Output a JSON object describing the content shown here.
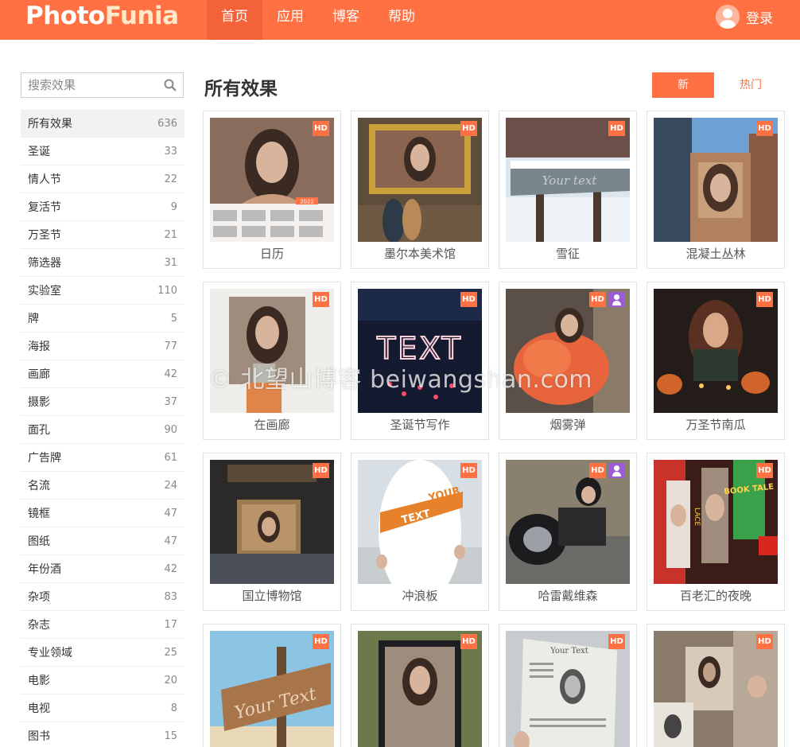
{
  "brand": {
    "photo": "Photo",
    "funia": "Funia"
  },
  "nav": [
    {
      "label": "首页"
    },
    {
      "label": "应用"
    },
    {
      "label": "博客"
    },
    {
      "label": "帮助"
    }
  ],
  "login": {
    "label": "登录"
  },
  "search": {
    "placeholder": "搜索效果"
  },
  "categories": [
    {
      "name": "所有效果",
      "count": "636"
    },
    {
      "name": "圣诞",
      "count": "33"
    },
    {
      "name": "情人节",
      "count": "22"
    },
    {
      "name": "复活节",
      "count": "9"
    },
    {
      "name": "万圣节",
      "count": "21"
    },
    {
      "name": "筛选器",
      "count": "31"
    },
    {
      "name": "实验室",
      "count": "110"
    },
    {
      "name": "牌",
      "count": "5"
    },
    {
      "name": "海报",
      "count": "77"
    },
    {
      "name": "画廊",
      "count": "42"
    },
    {
      "name": "摄影",
      "count": "37"
    },
    {
      "name": "面孔",
      "count": "90"
    },
    {
      "name": "广告牌",
      "count": "61"
    },
    {
      "name": "名流",
      "count": "24"
    },
    {
      "name": "镜框",
      "count": "47"
    },
    {
      "name": "图纸",
      "count": "47"
    },
    {
      "name": "年份酒",
      "count": "42"
    },
    {
      "name": "杂项",
      "count": "83"
    },
    {
      "name": "杂志",
      "count": "17"
    },
    {
      "name": "专业领域",
      "count": "25"
    },
    {
      "name": "电影",
      "count": "20"
    },
    {
      "name": "电视",
      "count": "8"
    },
    {
      "name": "图书",
      "count": "15"
    }
  ],
  "main": {
    "title": "所有效果",
    "sort_new": "新",
    "sort_hot": "热门",
    "hd_label": "HD"
  },
  "effects": [
    {
      "name": "日历"
    },
    {
      "name": "墨尔本美术馆"
    },
    {
      "name": "雪征"
    },
    {
      "name": "混凝土丛林"
    },
    {
      "name": "在画廊"
    },
    {
      "name": "圣诞节写作"
    },
    {
      "name": "烟雾弹"
    },
    {
      "name": "万圣节南瓜"
    },
    {
      "name": "国立博物馆"
    },
    {
      "name": "冲浪板"
    },
    {
      "name": "哈雷戴维森"
    },
    {
      "name": "百老汇的夜晚"
    },
    {
      "name": ""
    },
    {
      "name": ""
    },
    {
      "name": ""
    },
    {
      "name": ""
    }
  ],
  "thumb_text": {
    "calendar_year": "2022",
    "snow_sign": "Your text",
    "neon": "TEXT",
    "surf_1": "YOUR",
    "surf_2": "TEXT",
    "lace": "LACE",
    "broadway": "BOOK TALE",
    "beach_sign": "Your Text",
    "newspaper": "Your Text"
  },
  "watermark": "© 北望山博客 beiwangshan.com",
  "colors": {
    "brand": "#ff7043",
    "hd_badge": "#ff7043",
    "user_badge": "#9c5bd6"
  }
}
